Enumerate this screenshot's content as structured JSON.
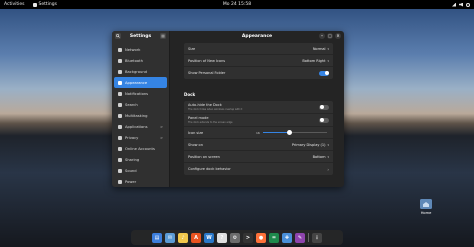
{
  "topbar": {
    "activities": "Activities",
    "app_name": "Settings",
    "clock": "Mo 24 15:58"
  },
  "sidebar": {
    "title": "Settings",
    "items": [
      {
        "label": "Network",
        "icon": "network-icon"
      },
      {
        "label": "Bluetooth",
        "icon": "bluetooth-icon"
      },
      {
        "label": "Background",
        "icon": "background-icon"
      },
      {
        "label": "Appearance",
        "icon": "appearance-icon",
        "active": true
      },
      {
        "label": "Notifications",
        "icon": "bell-icon"
      },
      {
        "label": "Search",
        "icon": "search-icon"
      },
      {
        "label": "Multitasking",
        "icon": "multitasking-icon"
      },
      {
        "label": "Applications",
        "icon": "apps-icon",
        "chevron": ">"
      },
      {
        "label": "Privacy",
        "icon": "privacy-icon",
        "chevron": ">"
      },
      {
        "label": "Online Accounts",
        "icon": "accounts-icon"
      },
      {
        "label": "Sharing",
        "icon": "sharing-icon"
      },
      {
        "label": "Sound",
        "icon": "sound-icon"
      },
      {
        "label": "Power",
        "icon": "power-icon"
      }
    ]
  },
  "main": {
    "title": "Appearance",
    "desktop_icons": {
      "size_label": "Size",
      "size_value": "Normal",
      "position_label": "Position of New Icons",
      "position_value": "Bottom Right",
      "show_folder_label": "Show Personal Folder",
      "show_folder_on": true
    },
    "dock": {
      "section_title": "Dock",
      "autohide_label": "Auto-hide the Dock",
      "autohide_sub": "The dock hides when windows overlap with it",
      "autohide_on": false,
      "panel_label": "Panel mode",
      "panel_sub": "The dock extends to the screen edge",
      "panel_on": false,
      "icon_size_label": "Icon size",
      "icon_size_min": "16",
      "icon_size_fraction": 0.42,
      "show_on_label": "Show on",
      "show_on_value": "Primary Display (1)",
      "position_label": "Position on screen",
      "position_value": "Bottom",
      "configure_label": "Configure dock behavior"
    }
  },
  "desktop": {
    "home_label": "Home"
  },
  "dock_bar": {
    "items": [
      {
        "icon": "files-icon",
        "color": "#3d7edb",
        "glyph": "▤"
      },
      {
        "icon": "mail-icon",
        "color": "#5b9bd5",
        "glyph": "✉"
      },
      {
        "icon": "media-icon",
        "color": "#f2c94c",
        "glyph": "♪"
      },
      {
        "icon": "software-icon",
        "color": "#e95420",
        "glyph": "A"
      },
      {
        "icon": "writer-icon",
        "color": "#2a78c8",
        "glyph": "W"
      },
      {
        "icon": "help-icon",
        "color": "#e0e0e0",
        "glyph": "?"
      },
      {
        "icon": "settings-icon",
        "color": "#6c6c6c",
        "glyph": "⚙"
      },
      {
        "icon": "terminal-icon",
        "color": "#333333",
        "glyph": ">"
      },
      {
        "icon": "firefox-icon",
        "color": "#ff7139",
        "glyph": "●"
      },
      {
        "icon": "calc-icon",
        "color": "#1e8a4c",
        "glyph": "="
      },
      {
        "icon": "extensions-icon",
        "color": "#4a90d9",
        "glyph": "✚"
      },
      {
        "icon": "paint-icon",
        "color": "#8e44ad",
        "glyph": "✎"
      },
      {
        "icon": "app-grid-icon",
        "color": "#444444",
        "glyph": "⋮"
      }
    ]
  }
}
